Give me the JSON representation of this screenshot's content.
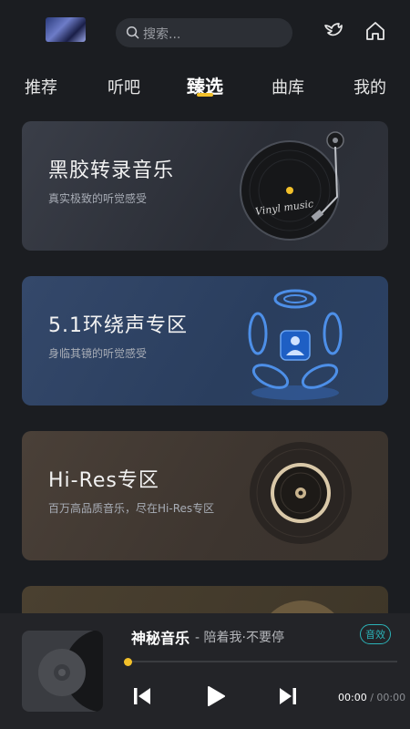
{
  "search": {
    "placeholder": "搜索..."
  },
  "tabs": [
    {
      "label": "推荐"
    },
    {
      "label": "听吧"
    },
    {
      "label": "臻选",
      "active": true
    },
    {
      "label": "曲库"
    },
    {
      "label": "我的"
    }
  ],
  "cards": [
    {
      "title": "黑胶转录音乐",
      "subtitle": "真实极致的听觉感受",
      "art_text": "Vinyl music"
    },
    {
      "title": "5.1环绕声专区",
      "subtitle": "身临其镜的听觉感受"
    },
    {
      "title": "Hi-Res专区",
      "subtitle": "百万高品质音乐，尽在Hi-Res专区"
    }
  ],
  "player": {
    "song_title": "神秘音乐",
    "song_subtitle": "- 陪着我·不要停",
    "effect_badge": "音效",
    "current_time": "00:00",
    "time_separator": "/",
    "total_time": "00:00",
    "progress": 0
  },
  "colors": {
    "accent": "#f2c02a",
    "badge": "#2bb3b8",
    "background": "#1b1d21"
  },
  "icons": [
    "search-icon",
    "bird-icon",
    "home-icon",
    "previous-icon",
    "play-icon",
    "next-icon"
  ]
}
